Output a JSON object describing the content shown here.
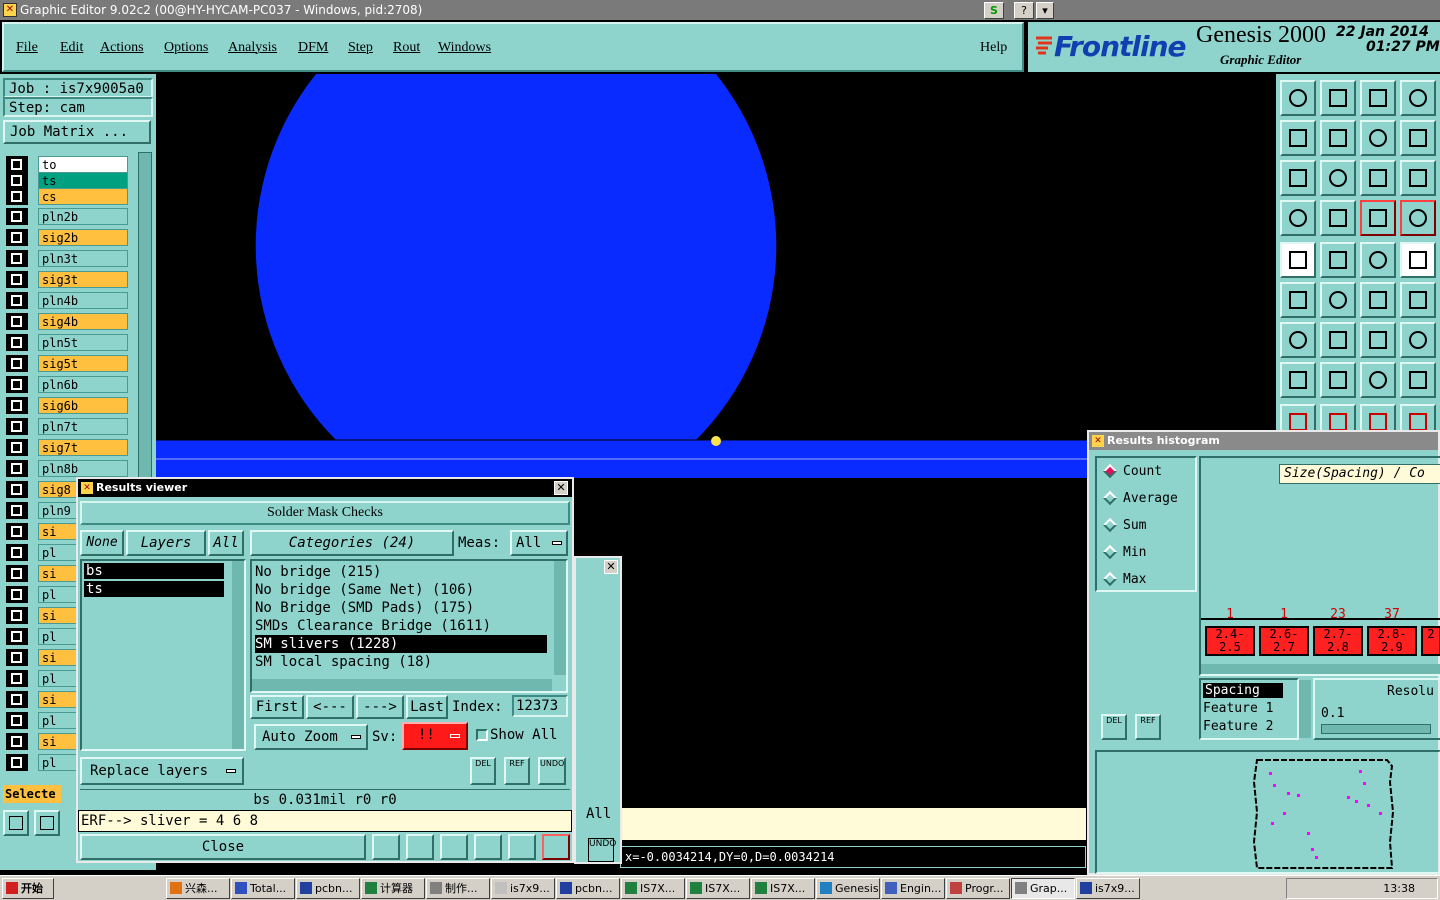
{
  "window": {
    "title": "Graphic Editor 9.02c2 (00@HY-HYCAM-PC037 - Windows, pid:2708)",
    "title_buttons": [
      "S",
      "?",
      "▾"
    ]
  },
  "menubar": {
    "items": [
      "File",
      "Edit",
      "Actions",
      "Options",
      "Analysis",
      "DFM",
      "Step",
      "Rout",
      "Windows"
    ],
    "help": "Help"
  },
  "brand": {
    "logo": "Frontline",
    "product": "Genesis 2000",
    "subtitle": "Graphic Editor",
    "date": "22 Jan 2014",
    "time": "01:27 PM"
  },
  "left_panel": {
    "job": "Job : is7x9005a0",
    "step": "Step: cam",
    "job_matrix": "Job Matrix ...",
    "layers": [
      {
        "name": "to",
        "color": "#ffffff"
      },
      {
        "name": "ts",
        "color": "#00a080"
      },
      {
        "name": "cs",
        "color": "#ffc040"
      },
      {
        "name": "pln2b",
        "color": "#8fd4cc"
      },
      {
        "name": "sig2b",
        "color": "#ffc040"
      },
      {
        "name": "pln3t",
        "color": "#8fd4cc"
      },
      {
        "name": "sig3t",
        "color": "#ffc040"
      },
      {
        "name": "pln4b",
        "color": "#8fd4cc"
      },
      {
        "name": "sig4b",
        "color": "#ffc040"
      },
      {
        "name": "pln5t",
        "color": "#8fd4cc"
      },
      {
        "name": "sig5t",
        "color": "#ffc040"
      },
      {
        "name": "pln6b",
        "color": "#8fd4cc"
      },
      {
        "name": "sig6b",
        "color": "#ffc040"
      },
      {
        "name": "pln7t",
        "color": "#8fd4cc"
      },
      {
        "name": "sig7t",
        "color": "#ffc040"
      },
      {
        "name": "pln8b",
        "color": "#8fd4cc"
      },
      {
        "name": "sig8",
        "color": "#ffc040"
      },
      {
        "name": "pln9",
        "color": "#8fd4cc"
      },
      {
        "name": "si",
        "color": "#ffc040"
      },
      {
        "name": "pl",
        "color": "#8fd4cc"
      },
      {
        "name": "si",
        "color": "#ffc040"
      },
      {
        "name": "pl",
        "color": "#8fd4cc"
      },
      {
        "name": "si",
        "color": "#ffc040"
      },
      {
        "name": "pl",
        "color": "#8fd4cc"
      },
      {
        "name": "si",
        "color": "#ffc040"
      },
      {
        "name": "pl",
        "color": "#8fd4cc"
      },
      {
        "name": "si",
        "color": "#ffc040"
      },
      {
        "name": "pl",
        "color": "#8fd4cc"
      },
      {
        "name": "si",
        "color": "#ffc040"
      },
      {
        "name": "pl",
        "color": "#8fd4cc"
      }
    ],
    "selected_label": "Selecte"
  },
  "canvas": {
    "colors": {
      "feature": "#0a2bff",
      "background": "#000000",
      "marker": "#ffe34a"
    }
  },
  "results_viewer": {
    "title": "Results viewer",
    "header": "Solder Mask Checks",
    "btn_none": "None",
    "btn_layers": "Layers",
    "btn_all": "All",
    "categories_label": "Categories (24)",
    "meas_label": "Meas:",
    "meas_value": "All",
    "layer_list": [
      "bs",
      "ts"
    ],
    "categories": [
      "No bridge (215)",
      "No bridge (Same Net) (106)",
      "No Bridge (SMD Pads) (175)",
      "SMDs Clearance Bridge (1611)",
      "SM slivers (1228)",
      "SM local spacing (18)"
    ],
    "selected_category": 4,
    "nav": {
      "first": "First",
      "prev": "<---",
      "next": "--->",
      "last": "Last"
    },
    "index_label": "Index:",
    "index_value": "12373",
    "auto_zoom": "Auto Zoom",
    "sv_label": "Sv:",
    "sv_value": "!!",
    "show_all": "Show All",
    "replace_layers": "Replace layers",
    "del": "DEL",
    "ref": "REF",
    "undo": "UNDO",
    "status": "bs 0.031mil   r0   r0",
    "erf": "ERF--> sliver = 4 6 8",
    "close": "Close"
  },
  "background_panel": {
    "text": "All",
    "undo": "UNDO"
  },
  "status_bar": {
    "coords": "x=-0.0034214,DY=0,D=0.0034214"
  },
  "histogram": {
    "title": "Results histogram",
    "modes": [
      "Count",
      "Average",
      "Sum",
      "Min",
      "Max"
    ],
    "selected_mode": 0,
    "axis_label": "Size(Spacing) / Co",
    "bins": [
      {
        "count": "1",
        "range": "2.4-\n2.5"
      },
      {
        "count": "1",
        "range": "2.6-\n2.7"
      },
      {
        "count": "23",
        "range": "2.7-\n2.8"
      },
      {
        "count": "37",
        "range": "2.8-\n2.9"
      },
      {
        "count": "",
        "range": "2"
      }
    ],
    "list": [
      "Spacing",
      "Feature 1",
      "Feature 2"
    ],
    "resolution_label": "Resolu",
    "resolution_value": "0.1",
    "del": "DEL",
    "ref": "REF"
  },
  "taskbar": {
    "start": "开始",
    "tasks": [
      "兴森...",
      "Total...",
      "pcbn...",
      "计算器",
      "制作...",
      "is7x9...",
      "pcbn...",
      "IS7X...",
      "IS7X...",
      "IS7X...",
      "Genesis",
      "Engin...",
      "Progr...",
      "Grap...",
      "is7x9..."
    ],
    "clock": "13:38"
  }
}
